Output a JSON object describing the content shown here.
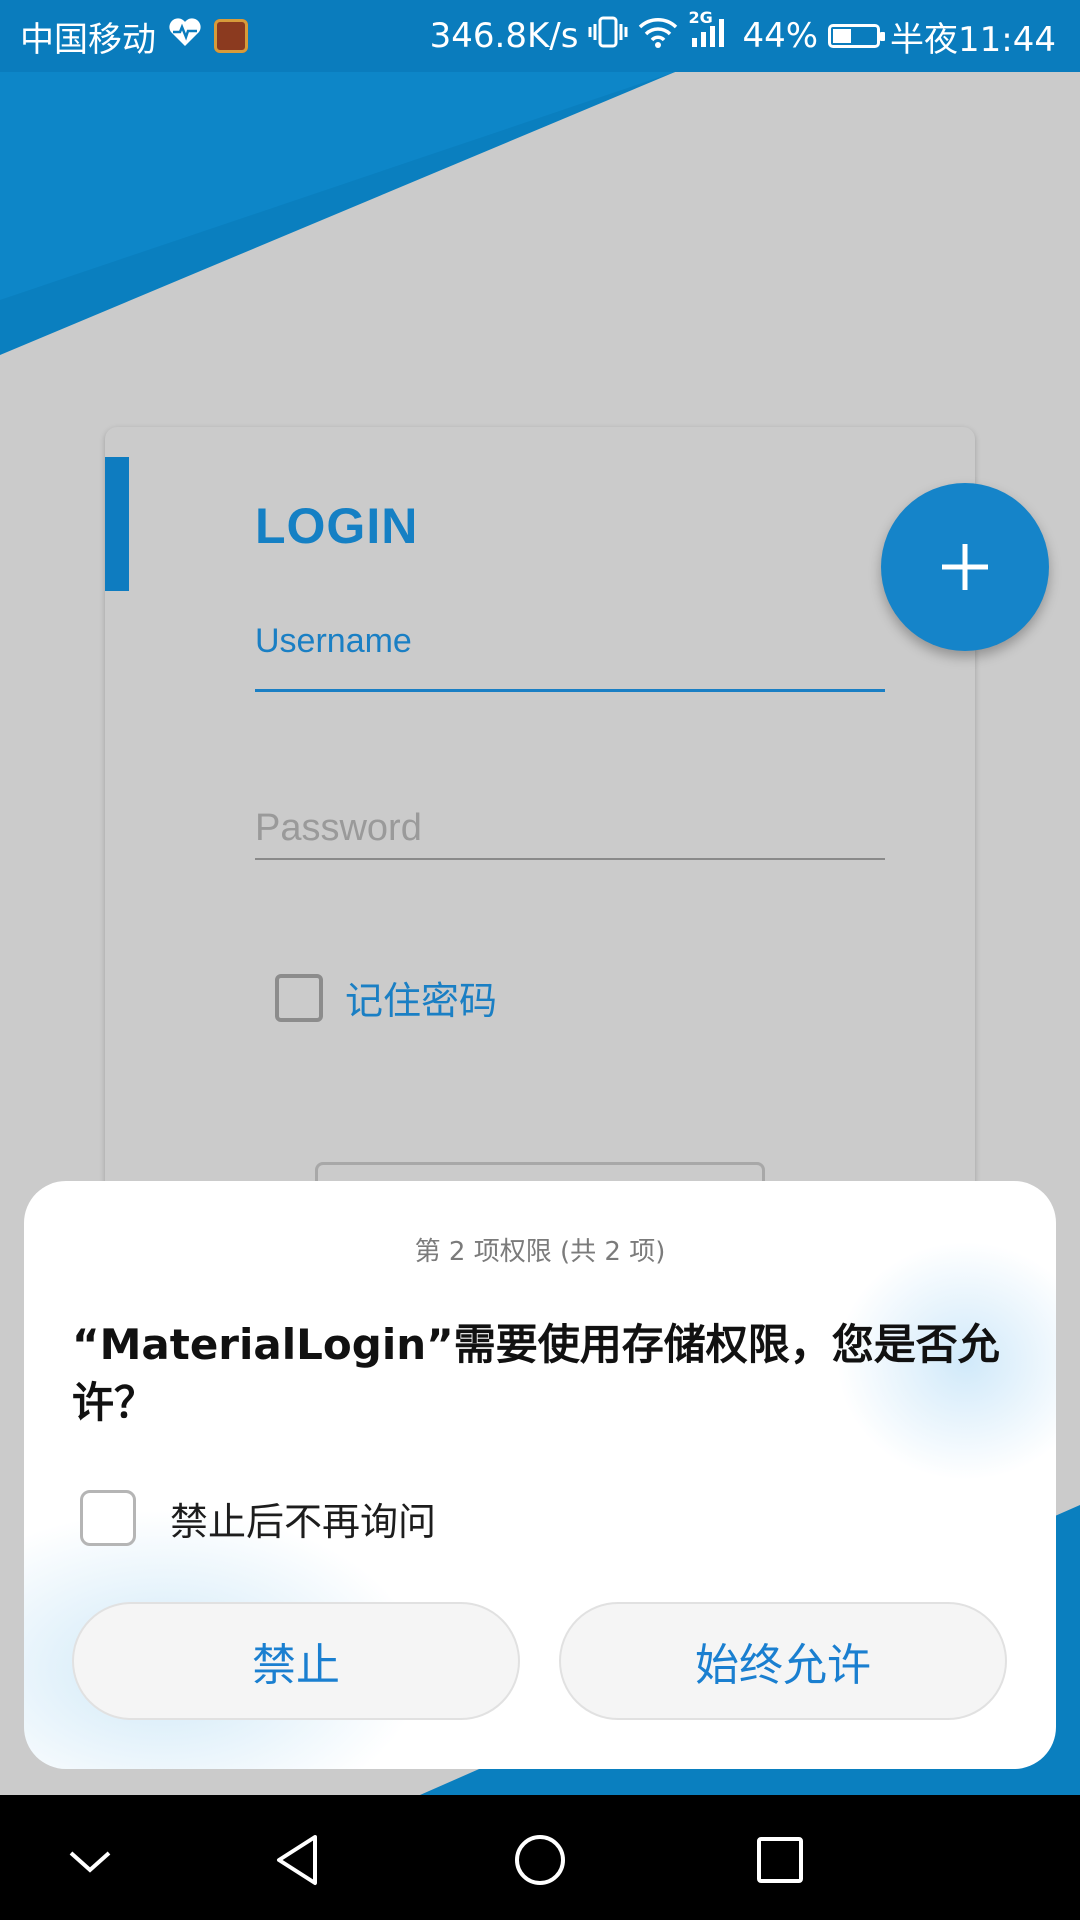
{
  "status_bar": {
    "carrier": "中国移动",
    "speed": "346.8K/s",
    "network": "2G",
    "battery": "44%",
    "battery_level": 0.44,
    "time": "半夜11:44",
    "icons": [
      "heart-rate-icon",
      "app-notification-icon",
      "vibrate-icon",
      "wifi-icon",
      "signal-icon",
      "battery-icon"
    ]
  },
  "login_card": {
    "title": "LOGIN",
    "username_label": "Username",
    "password_placeholder": "Password",
    "remember_label": "记住密码",
    "fab_icon": "plus-icon"
  },
  "permission_dialog": {
    "counter": "第 2 项权限 (共 2 项)",
    "message": "“MaterialLogin”需要使用存储权限，您是否允许？",
    "dont_ask_label": "禁止后不再询问",
    "deny_label": "禁止",
    "allow_label": "始终允许"
  },
  "nav_bar": {
    "icons": [
      "collapse-icon",
      "back-icon",
      "home-icon",
      "recents-icon"
    ]
  },
  "colors": {
    "primary": "#1584c9",
    "status_bar": "#0a7cbd",
    "dim_background": "#cbcbcb"
  }
}
